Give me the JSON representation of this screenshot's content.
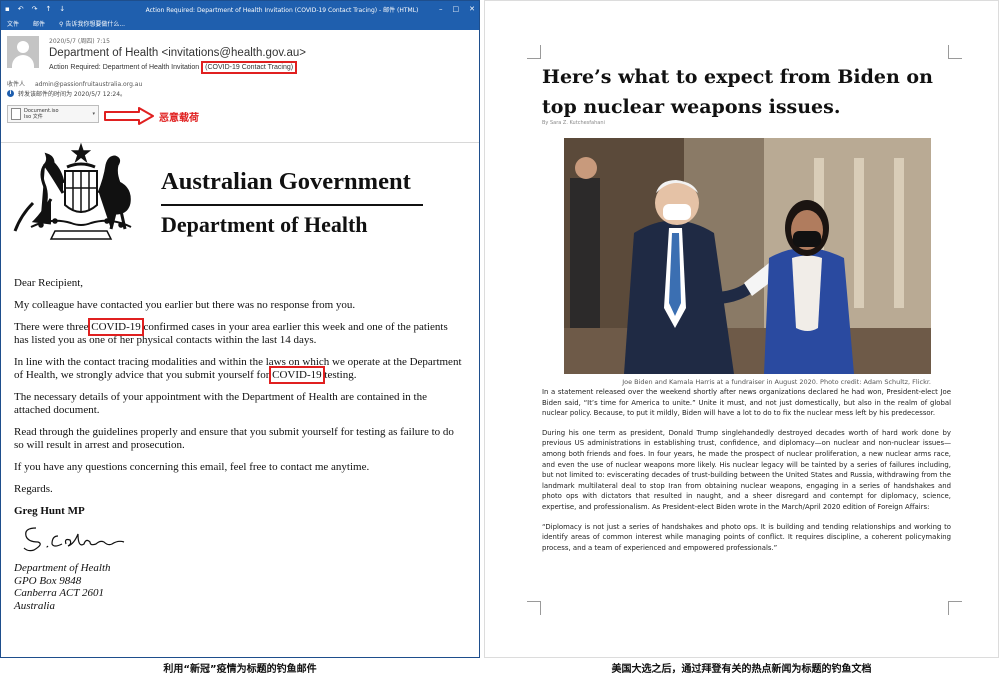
{
  "email": {
    "window_title": "Action Required: Department of Health Invitation (COVID-19 Contact Tracing) - 邮件 (HTML)",
    "ribbon_tabs": [
      "文件",
      "邮件",
      "告诉我你想要做什么..."
    ],
    "date": "2020/5/7 (周四) 7:15",
    "sender": "Department of Health <invitations@health.gov.au>",
    "subject_prefix": "Action Required: Department of Health Invitation",
    "subject_highlight": "(COVID-19 Contact Tracing)",
    "to_label": "收件人",
    "to_value": "admin@passionfruitaustralia.org.au",
    "info_text": "转发该邮件的时间为 2020/5/7 12:24。",
    "attachment": {
      "name": "Document.iso",
      "type": "Iso 文件"
    },
    "payload_label": "恶意载荷",
    "letterhead": {
      "line1": "Australian Government",
      "line2": "Department of Health"
    },
    "letter": {
      "greeting": "Dear Recipient,",
      "p1": "My colleague have contacted you earlier but there was no response from you.",
      "p2_a": "There were three ",
      "p2_hl": "COVID-19",
      "p2_b": " confirmed cases in your area earlier this week and one of the patients has listed you as one of  her physical contacts within the last 14 days.",
      "p3_a": "In line with the contact tracing modalities and within the laws on which we operate at the Department of Health, we strongly advice that you submit yourself  for ",
      "p3_hl": "COVID-19",
      "p3_b": " testing.",
      "p4": "The necessary details of your appointment with the Department of Health are contained in the attached document.",
      "p5": "Read through the guidelines properly and ensure that you submit yourself for testing as failure to do so will result in arrest and prosecution.",
      "p6": "If you have any questions concerning this email, feel free to contact me anytime.",
      "closing": "Regards.",
      "signatory": "Greg Hunt MP",
      "address": [
        "Department of Health",
        "GPO Box 9848",
        "Canberra ACT 2601",
        "Australia"
      ]
    },
    "caption": "利用“新冠”疫情为标题的钓鱼邮件"
  },
  "document": {
    "title": "Here’s what to expect from Biden on top nuclear weapons issues.",
    "byline": "By Sara Z. Kutchesfahani",
    "photo_caption": "Joe Biden and Kamala Harris at a fundraiser in August 2020. Photo credit: Adam Schultz, Flickr.",
    "paragraphs": [
      "In a statement released over the weekend shortly after news organizations declared he had won, President-elect Joe Biden said, “It’s time for America to unite.” Unite it must, and not just domestically, but also in the realm of global nuclear policy. Because, to put it mildly, Biden will have a lot to do to fix the nuclear mess left by his predecessor.",
      "During his one term as president, Donald Trump singlehandedly destroyed decades worth of hard work done by previous US administrations in establishing trust, confidence, and diplomacy—on nuclear and non-nuclear issues—among both friends and foes. In four years, he made the prospect of nuclear proliferation, a new nuclear arms race, and even the use of nuclear weapons more likely. His nuclear legacy will be tainted by a series of failures including, but not limited to: eviscerating decades of trust-building between the United States and Russia, withdrawing from the landmark multilateral deal to stop Iran from obtaining nuclear weapons, engaging in a series of handshakes and photo ops with dictators that resulted in naught, and a sheer disregard and contempt for diplomacy, science, expertise, and professionalism. As President-elect Biden wrote in the March/April 2020 edition of Foreign Affairs:",
      "“Diplomacy is not just a series of handshakes and photo ops. It is building and tending relationships and working to identify areas of common interest while managing points of conflict. It requires discipline, a coherent policymaking process, and a team of experienced and empowered professionals.”"
    ],
    "caption": "美国大选之后，通过拜登有关的热点新闻为标题的钓鱼文档"
  },
  "colors": {
    "titlebar": "#1f5fae",
    "highlight": "#e02020"
  },
  "icons": [
    "save-icon",
    "undo-icon",
    "redo-icon",
    "up-arrow-icon",
    "down-arrow-icon",
    "minimize-icon",
    "maximize-icon",
    "close-icon",
    "lightbulb-icon",
    "info-icon",
    "iso-file-icon",
    "arrow-icon",
    "coat-of-arms-icon"
  ]
}
